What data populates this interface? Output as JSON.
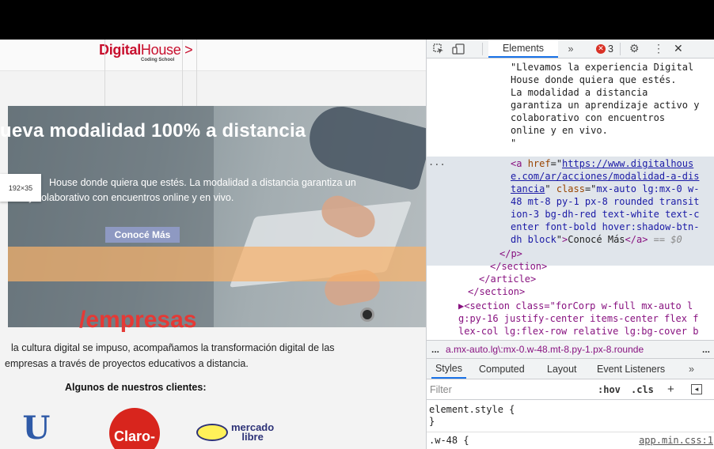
{
  "website": {
    "logo": {
      "brand_bold": "Digital",
      "brand_light": "House",
      "arrow": ">",
      "tagline": "Coding School"
    },
    "hero": {
      "title": "ueva modalidad 100% a distancia",
      "text_line1": "House donde quiera que estés. La modalidad a distancia garantiza un",
      "text_line2": "activo y colaborativo con encuentros online y en vivo.",
      "size_tooltip": "192×35",
      "cta_label": "Conocé Más"
    },
    "empresas": {
      "title": "/empresas",
      "text_line1": "la cultura digital se impuso, acompañamos la transformación digital de las",
      "text_line2": "empresas a través de proyectos educativos a distancia.",
      "clients_title": "Algunos de nuestros clientes:"
    },
    "clients": {
      "unilever_glyph": "U",
      "claro": "Claro-",
      "mercadolibre_line1": "mercado",
      "mercadolibre_line2": "libre"
    }
  },
  "devtools": {
    "toolbar": {
      "inspect_icon": "inspect-icon",
      "device_icon": "device-toggle-icon",
      "active_tab": "Elements",
      "more_tabs": "»",
      "error_count": "3",
      "settings_icon": "gear-icon",
      "menu_icon": "kebab-icon",
      "close": "✕"
    },
    "dom": {
      "text_lines": [
        "\"Llevamos la experiencia Digital",
        "House donde quiera que estés.",
        "La modalidad a distancia",
        "garantiza un aprendizaje activo y",
        "colaborativo con encuentros",
        "online y en vivo.",
        "\""
      ],
      "selected": {
        "ellipsis": "...",
        "open_tag": "<a",
        "href_attr": "href",
        "href_l1": "https://www.digitalhous",
        "href_l2": "e.com/ar/acciones/modalidad-a-dis",
        "href_l3": "tancia",
        "class_attr": "class",
        "class_l1": "mx-auto lg:mx-0 w-",
        "class_l2": "48 mt-8 py-1 px-8 rounded transit",
        "class_l3": "ion-3 bg-dh-red text-white text-c",
        "class_l4": "enter font-bold hover:shadow-btn-",
        "class_l5": "dh block",
        "link_text": "Conocé Más",
        "close_tag": "</a>",
        "eq": "== $0"
      },
      "close_p": "</p>",
      "close_section": "</section>",
      "close_article": "</article>",
      "close_section2": "</section>",
      "next_section_l1": "▶<section class=\"forCorp w-full mx-auto l",
      "next_section_l2": "g:py-16 justify-center items-center flex f",
      "next_section_l3": "lex-col lg:flex-row relative lg:bg-cover b"
    },
    "breadcrumb": {
      "dots_left": "...",
      "path": "a.mx-auto.lg\\:mx-0.w-48.mt-8.py-1.px-8.rounde",
      "dots_right": "..."
    },
    "subtabs": [
      "Styles",
      "Computed",
      "Layout",
      "Event Listeners",
      "»"
    ],
    "filter": {
      "placeholder": "Filter",
      "hov": ":hov",
      "cls": ".cls",
      "plus": "+",
      "toggle": "◂"
    },
    "styles": {
      "element_style_open": "element.style {",
      "element_style_close": "}",
      "rule_selector": ".w-48 {",
      "rule_source": "app.min.css:1"
    }
  },
  "colors": {
    "brand_red": "#c8102e",
    "empresas_red": "#e53935",
    "cta_bg": "#8e99c2",
    "highlight_bar": "#f6b26b",
    "devtools_accent": "#1a73e8",
    "error_badge": "#d93025"
  }
}
